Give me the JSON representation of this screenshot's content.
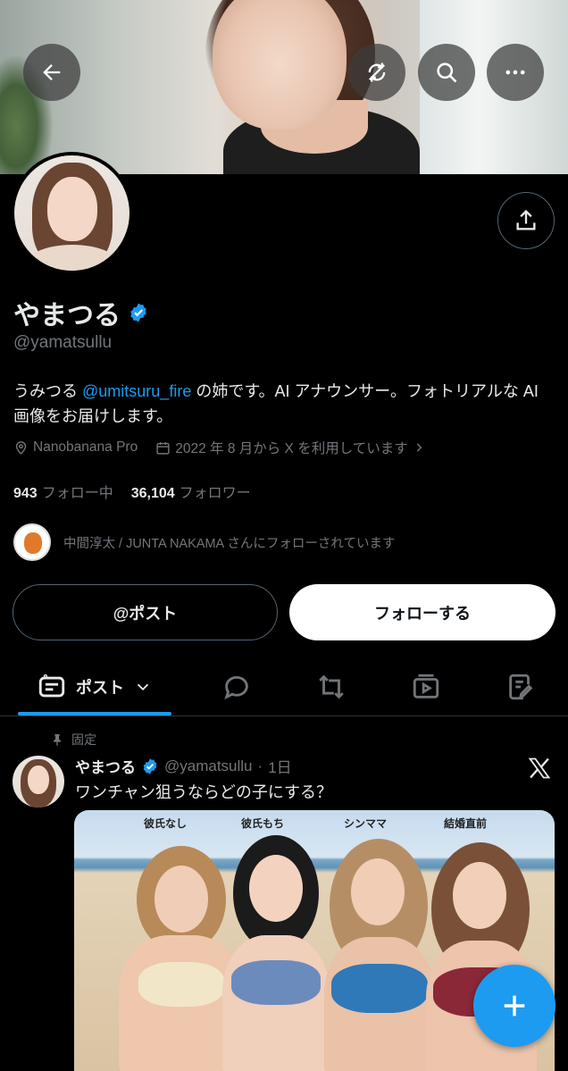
{
  "header": {
    "back_icon": "arrow-left-icon",
    "translate_icon": "no-translate-icon",
    "search_icon": "search-icon",
    "more_icon": "more-horizontal-icon"
  },
  "profile": {
    "name": "やまつる",
    "handle": "@yamatsullu",
    "bio_before": "うみつる ",
    "bio_mention": "@umitsuru_fire",
    "bio_after": " の姉です。AI アナウンサー。フォトリアルな AI 画像をお届けします。",
    "location": "Nanobanana Pro",
    "joined": "2022 年 8 月から X を利用しています",
    "following_count": "943",
    "following_label": "フォロー中",
    "followers_count": "36,104",
    "followers_label": "フォロワー",
    "followed_by": "中間淳太 / JUNTA NAKAMA さんにフォローされています"
  },
  "actions": {
    "post_label": "@ポスト",
    "follow_label": "フォローする"
  },
  "tabs": {
    "posts_label": "ポスト"
  },
  "post": {
    "pinned_label": "固定",
    "author_name": "やまつる",
    "author_handle": "@yamatsullu",
    "time": "1日",
    "text": "ワンチャン狙うならどの子にする？",
    "image_labels": [
      "彼氏なし",
      "彼氏もち",
      "シンママ",
      "結婚直前"
    ]
  },
  "colors": {
    "accent": "#1d9bf0",
    "muted": "#71767b",
    "background": "#000000",
    "border": "#2f3336"
  }
}
